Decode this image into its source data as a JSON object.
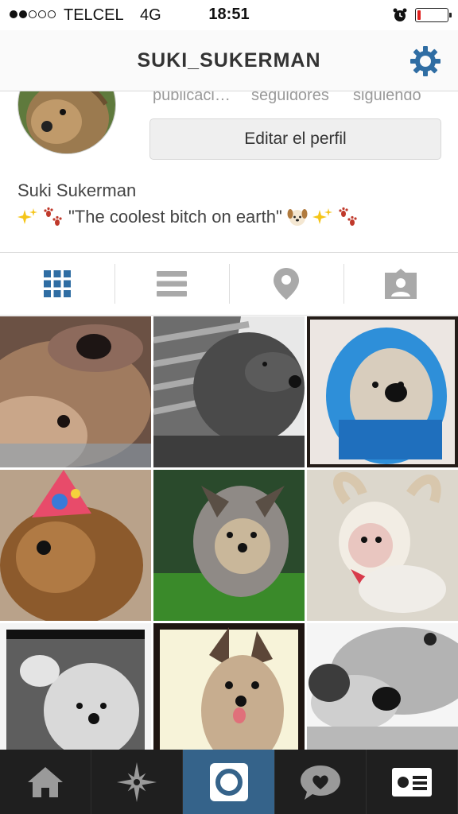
{
  "status_bar": {
    "carrier": "TELCEL",
    "network": "4G",
    "time": "18:51",
    "signal_bars": 2,
    "signal_total": 5,
    "battery_level": 0.12,
    "battery_color": "#e0201e"
  },
  "nav": {
    "title": "SUKI_SUKERMAN",
    "settings_icon": "gear-icon",
    "accent_color": "#2f6da3"
  },
  "profile": {
    "stats": [
      "publicaci…",
      "seguidores",
      "siguiendo"
    ],
    "edit_button": "Editar el perfil",
    "full_name": "Suki Sukerman",
    "bio_text": "\"The coolest bitch on earth\"",
    "bio_icons": [
      "sparkles-emoji",
      "paw-prints-emoji",
      "dog-face-emoji",
      "sparkles-emoji",
      "paw-prints-emoji"
    ]
  },
  "view_tabs": [
    {
      "name": "grid-view",
      "icon": "grid-icon",
      "active": true
    },
    {
      "name": "list-view",
      "icon": "list-icon",
      "active": false
    },
    {
      "name": "map-view",
      "icon": "location-pin-icon",
      "active": false
    },
    {
      "name": "tagged-view",
      "icon": "tagged-person-icon",
      "active": false
    }
  ],
  "photos": [
    {
      "subject": "dog close-up, warm tones"
    },
    {
      "subject": "dog in scarf, black and white"
    },
    {
      "subject": "dog in blue hoodie"
    },
    {
      "subject": "dog with party hat"
    },
    {
      "subject": "dog on grass"
    },
    {
      "subject": "dog in reindeer costume"
    },
    {
      "subject": "dog portrait, black and white"
    },
    {
      "subject": "dog portrait, framed"
    },
    {
      "subject": "dog lying down, black and white"
    }
  ],
  "bottom_tabs": [
    {
      "name": "home",
      "icon": "home-icon",
      "active": false
    },
    {
      "name": "explore",
      "icon": "compass-star-icon",
      "active": false
    },
    {
      "name": "camera",
      "icon": "camera-icon",
      "active": true
    },
    {
      "name": "activity",
      "icon": "heart-bubble-icon",
      "active": false
    },
    {
      "name": "profile",
      "icon": "profile-card-icon",
      "active": false
    }
  ]
}
